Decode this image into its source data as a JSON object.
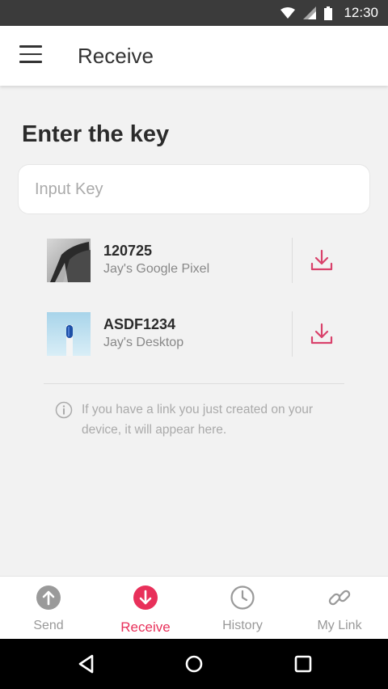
{
  "status_bar": {
    "time": "12:30",
    "icons": [
      "wifi-icon",
      "signal-icon",
      "battery-icon"
    ]
  },
  "app_bar": {
    "title": "Receive",
    "menu_icon": "hamburger-menu-icon"
  },
  "heading": "Enter the key",
  "key_input": {
    "value": "",
    "placeholder": "Input Key"
  },
  "items": [
    {
      "name": "120725",
      "device": "Jay's Google Pixel",
      "icon": "download-icon"
    },
    {
      "name": "ASDF1234",
      "device": "Jay's Desktop",
      "icon": "download-icon"
    }
  ],
  "info": {
    "text": "If you have a link you just created on your device, it will appear here.",
    "icon": "info-icon"
  },
  "bottom_nav": [
    {
      "label": "Send",
      "icon": "upload-arrow-icon",
      "active": false
    },
    {
      "label": "Receive",
      "icon": "download-arrow-icon",
      "active": true
    },
    {
      "label": "History",
      "icon": "clock-icon",
      "active": false
    },
    {
      "label": "My Link",
      "icon": "link-icon",
      "active": false
    }
  ],
  "colors": {
    "accent": "#e8305a",
    "inactive": "#999999",
    "status_bar": "#3b3b3b",
    "background": "#f2f2f2"
  }
}
